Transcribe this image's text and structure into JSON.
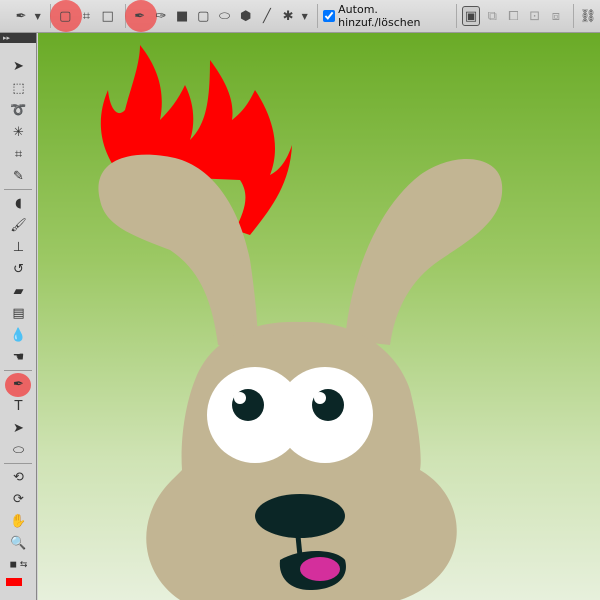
{
  "options_bar": {
    "tool_icons": [
      "pen-icon",
      "chevron-down-icon",
      "shape-layers-icon",
      "paths-icon",
      "fill-pixels-icon",
      "pen-tool-icon",
      "freeform-pen-icon",
      "rectangle-icon",
      "rounded-rectangle-icon",
      "ellipse-icon",
      "polygon-icon",
      "line-icon",
      "custom-shape-icon",
      "chevron-down-icon"
    ],
    "auto_add_delete_label": "Autom. hinzuf./löschen",
    "auto_add_delete_checked": true,
    "path_ops": [
      "create-new-icon",
      "add-icon",
      "subtract-icon",
      "intersect-icon",
      "exclude-icon"
    ]
  },
  "tools_panel": {
    "collapse": "▸▸",
    "tools": [
      "move",
      "marquee",
      "lasso",
      "magic-wand",
      "crop",
      "eyedropper",
      "healing-brush",
      "brush",
      "clone-stamp",
      "history-brush",
      "eraser",
      "gradient",
      "blur",
      "dodge",
      "pen",
      "type",
      "path-selection",
      "ellipse",
      "3d-rotate",
      "3d-orbit",
      "hand",
      "zoom"
    ],
    "type_glyph": "T",
    "foreground_color": "#ff0000"
  },
  "colors": {
    "flame": "#ff0000",
    "bunny": "#c2b593",
    "eye_white": "#ffffff",
    "pupil": "#0b2626",
    "tongue": "#d42f9c",
    "highlight": "#f05050"
  }
}
